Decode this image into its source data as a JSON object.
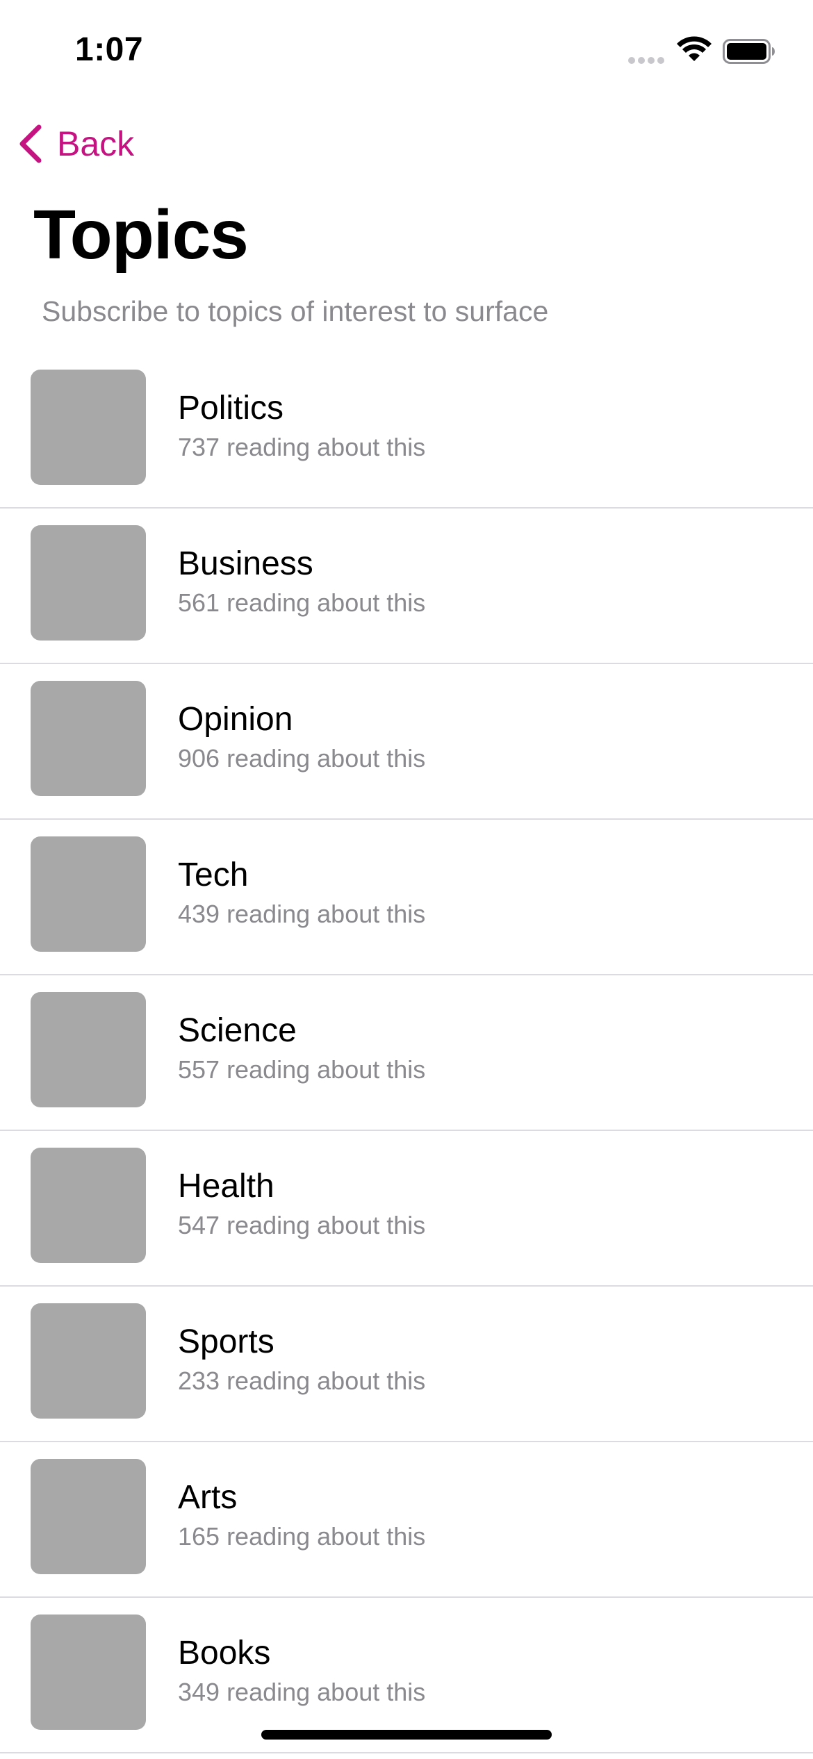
{
  "status_bar": {
    "time": "1:07"
  },
  "nav": {
    "back_label": "Back",
    "accent_color": "#c51382"
  },
  "header": {
    "title": "Topics",
    "subtitle": "Subscribe to topics of interest to surface"
  },
  "topics": [
    {
      "name": "Politics",
      "count": "737 reading about this"
    },
    {
      "name": "Business",
      "count": "561 reading about this"
    },
    {
      "name": "Opinion",
      "count": "906 reading about this"
    },
    {
      "name": "Tech",
      "count": "439 reading about this"
    },
    {
      "name": "Science",
      "count": "557 reading about this"
    },
    {
      "name": "Health",
      "count": "547 reading about this"
    },
    {
      "name": "Sports",
      "count": "233 reading about this"
    },
    {
      "name": "Arts",
      "count": "165 reading about this"
    },
    {
      "name": "Books",
      "count": "349 reading about this"
    }
  ],
  "icons": {
    "back": "chevron-left-icon",
    "wifi": "wifi-icon",
    "battery": "battery-icon",
    "signal": "signal-icon"
  }
}
